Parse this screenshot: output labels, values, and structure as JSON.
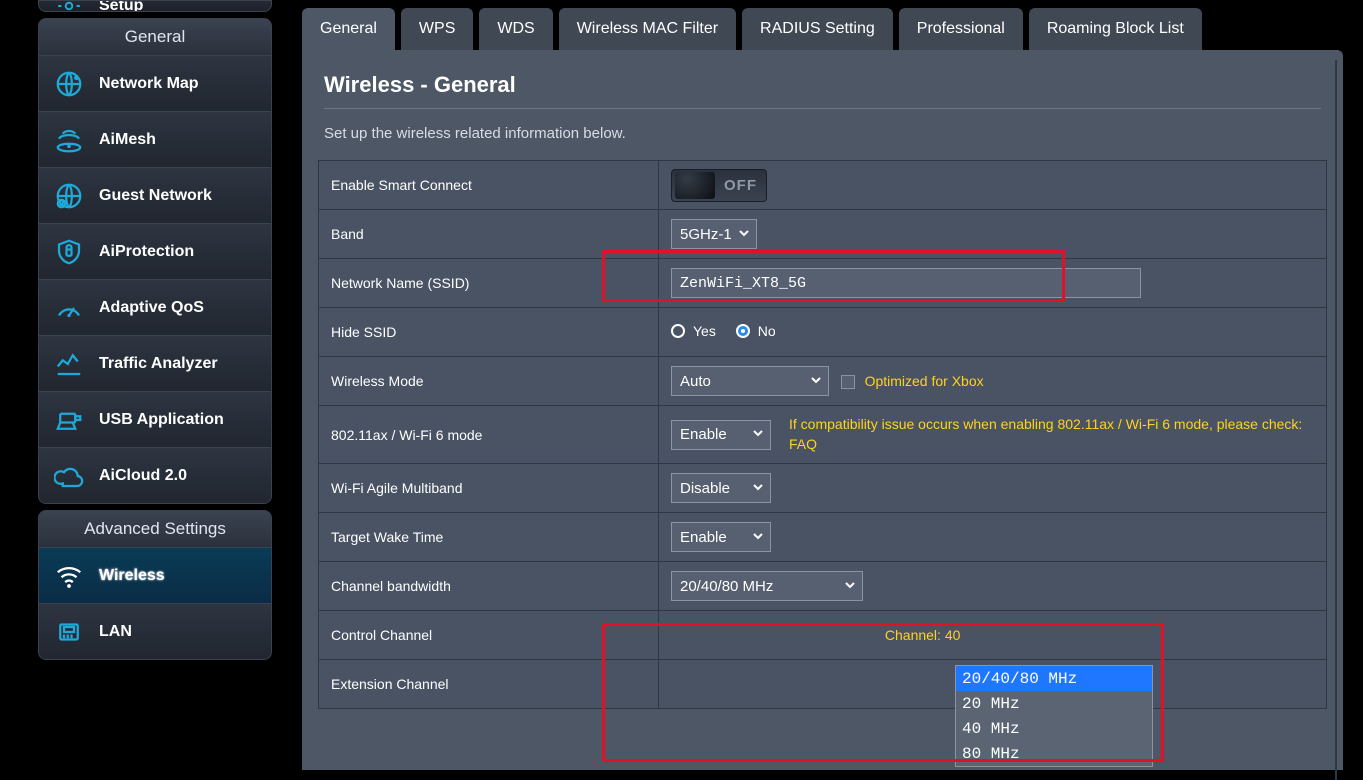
{
  "sidebar_top_clip": {
    "label": "Setup"
  },
  "general_panel": {
    "title": "General",
    "items": [
      {
        "label": "Network Map"
      },
      {
        "label": "AiMesh"
      },
      {
        "label": "Guest Network"
      },
      {
        "label": "AiProtection"
      },
      {
        "label": "Adaptive QoS"
      },
      {
        "label": "Traffic Analyzer"
      },
      {
        "label": "USB Application"
      },
      {
        "label": "AiCloud 2.0"
      }
    ]
  },
  "advanced_panel": {
    "title": "Advanced Settings",
    "items": [
      {
        "label": "Wireless",
        "active": true
      },
      {
        "label": "LAN"
      }
    ]
  },
  "tabs": [
    {
      "label": "General",
      "active": true
    },
    {
      "label": "WPS"
    },
    {
      "label": "WDS"
    },
    {
      "label": "Wireless MAC Filter"
    },
    {
      "label": "RADIUS Setting"
    },
    {
      "label": "Professional"
    },
    {
      "label": "Roaming Block List"
    }
  ],
  "page": {
    "title": "Wireless - General",
    "helper": "Set up the wireless related information below."
  },
  "fields": {
    "smart_connect": {
      "label": "Enable Smart Connect",
      "state": "OFF"
    },
    "band": {
      "label": "Band",
      "value": "5GHz-1"
    },
    "ssid": {
      "label": "Network Name (SSID)",
      "value": "ZenWiFi_XT8_5G"
    },
    "hide_ssid": {
      "label": "Hide SSID",
      "yes": "Yes",
      "no": "No",
      "selected": "no"
    },
    "wireless_mode": {
      "label": "Wireless Mode",
      "value": "Auto",
      "xbox_label": "Optimized for Xbox"
    },
    "wifi6": {
      "label": "802.11ax / Wi-Fi 6 mode",
      "value": "Enable",
      "note_prefix": "If compatibility issue occurs when enabling 802.11ax / Wi-Fi 6 mode, please check: ",
      "note_link": "FAQ"
    },
    "agile": {
      "label": "Wi-Fi Agile Multiband",
      "value": "Disable"
    },
    "twt": {
      "label": "Target Wake Time",
      "value": "Enable"
    },
    "bandwidth": {
      "label": "Channel bandwidth",
      "value": "20/40/80 MHz",
      "options": [
        "20/40/80 MHz",
        "20 MHz",
        "40 MHz",
        "80 MHz"
      ]
    },
    "control_channel": {
      "label": "Control Channel",
      "note": "Channel: 40"
    },
    "ext_channel": {
      "label": "Extension Channel"
    }
  }
}
